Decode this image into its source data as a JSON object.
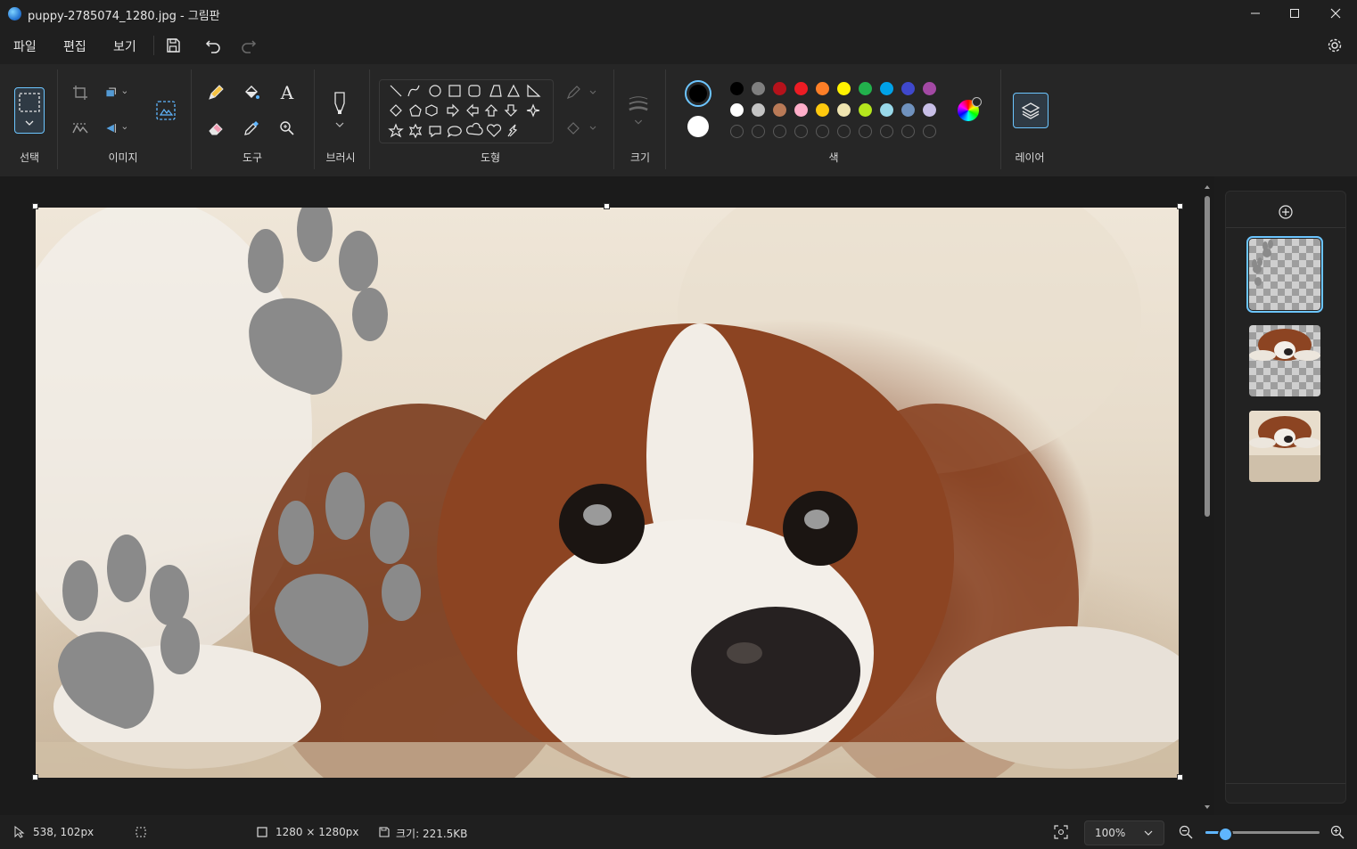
{
  "window": {
    "title": "puppy-2785074_1280.jpg - 그림판"
  },
  "menu": {
    "file": "파일",
    "edit": "편집",
    "view": "보기"
  },
  "ribbon": {
    "groups": {
      "select": "선택",
      "image": "이미지",
      "tools": "도구",
      "brush": "브러시",
      "shapes": "도형",
      "size": "크기",
      "color": "색",
      "layers": "레이어"
    },
    "text_tool_glyph": "A"
  },
  "palette": {
    "primary": "#000000",
    "secondary": "#ffffff",
    "row1": [
      "#000000",
      "#7f7f7f",
      "#b5121b",
      "#ed1c24",
      "#ff7f27",
      "#fff200",
      "#22b14c",
      "#00a2e8",
      "#3f48cc",
      "#a349a4"
    ],
    "row2": [
      "#ffffff",
      "#c3c3c3",
      "#b97a57",
      "#ffaec9",
      "#ffc90e",
      "#efe4b0",
      "#b5e61d",
      "#99d9ea",
      "#7092be",
      "#c8bfe7"
    ]
  },
  "status": {
    "cursor_pos": "538, 102px",
    "canvas_size": "1280 × 1280px",
    "file_size": "크기: 221.5KB",
    "zoom": "100%",
    "zoom_slider_fraction": 0.17
  }
}
